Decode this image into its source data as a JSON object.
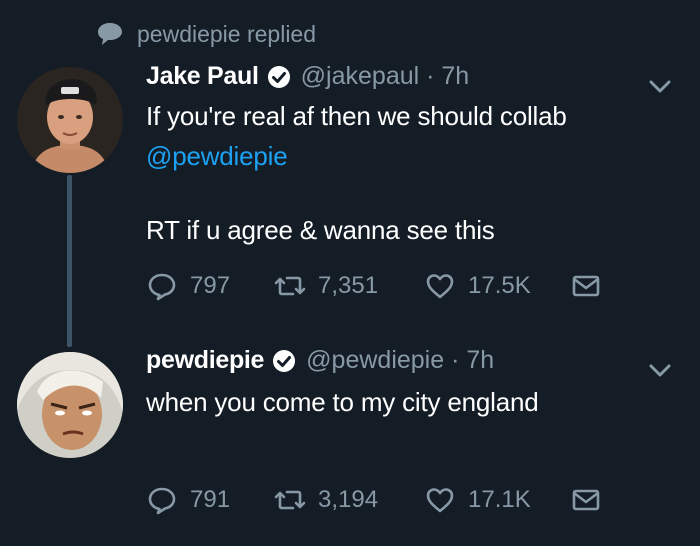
{
  "context": {
    "text": "pewdiepie replied",
    "icon": "speech-bubble-icon"
  },
  "tweets": [
    {
      "name": "Jake Paul",
      "handle": "@jakepaul · 7h",
      "text_line1": "If you're real af then we should collab",
      "mention": "@pewdiepie",
      "text_line2": "RT if u agree & wanna see this",
      "replies": "797",
      "retweets": "7,351",
      "likes": "17.5K"
    },
    {
      "name": "pewdiepie",
      "handle": "@pewdiepie · 7h",
      "text_line1": "when you come to my city england",
      "replies": "791",
      "retweets": "3,194",
      "likes": "17.1K"
    }
  ],
  "colors": {
    "background": "#141c26",
    "muted": "#8899a6",
    "link": "#1da1f2",
    "thread": "#3d5466"
  }
}
